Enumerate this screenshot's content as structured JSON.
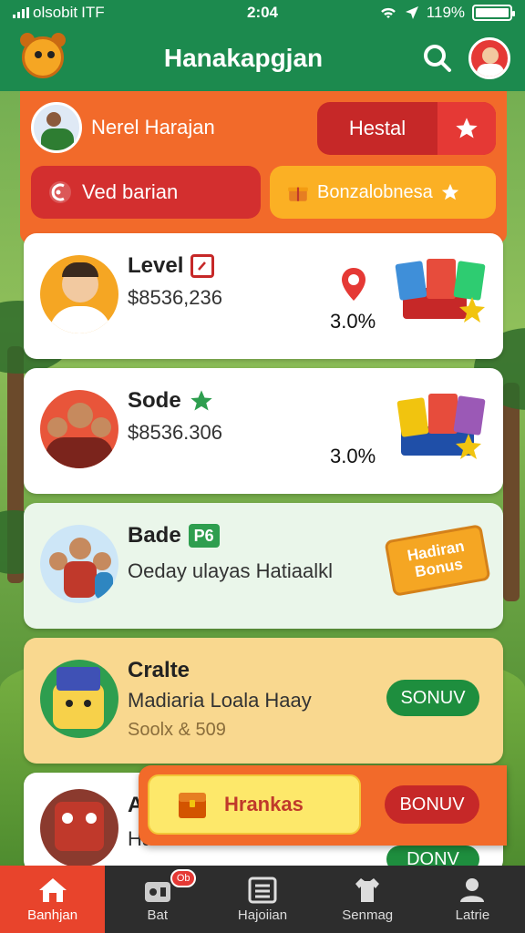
{
  "status_bar": {
    "carrier": "olsobit",
    "network": "ITF",
    "time": "2:04",
    "battery": "119%",
    "battery_level": 1.0
  },
  "header": {
    "title": "Hanakapgjan"
  },
  "profile": {
    "name": "Nerel Harajan"
  },
  "top_buttons": {
    "hestal": "Hestal",
    "ved": "Ved barian",
    "bonus": "Bonzalobnesa"
  },
  "cards": [
    {
      "title": "Level",
      "subtitle": "$8536,236",
      "percent": "3.0%"
    },
    {
      "title": "Sode",
      "subtitle": "$8536.306",
      "percent": "3.0%"
    },
    {
      "title": "Bade",
      "badge": "P6",
      "subtitle": "Oeday ulayas Hatiaalkl",
      "ribbon": "Hadiran Bonus"
    },
    {
      "title": "Cralte",
      "subtitle": "Madiaria Loala Haay",
      "detail": "Soolx & 509",
      "button": "SONUV"
    },
    {
      "title": "A",
      "subtitle": "Ha",
      "button": "DONV"
    }
  ],
  "popup": {
    "label": "Hrankas",
    "button": "BONUV"
  },
  "tabbar": {
    "tabs": [
      {
        "label": "Banhjan",
        "icon": "home-icon",
        "active": true
      },
      {
        "label": "Bat",
        "icon": "gamepad-icon",
        "badge": "Ob"
      },
      {
        "label": "Hajoiian",
        "icon": "list-icon"
      },
      {
        "label": "Senmag",
        "icon": "shirt-icon"
      },
      {
        "label": "Latrie",
        "icon": "user-icon"
      }
    ]
  },
  "colors": {
    "brand_green": "#1c8a4e",
    "panel_orange": "#f26a2a",
    "red": "#c62828",
    "yellow": "#fbb024"
  }
}
